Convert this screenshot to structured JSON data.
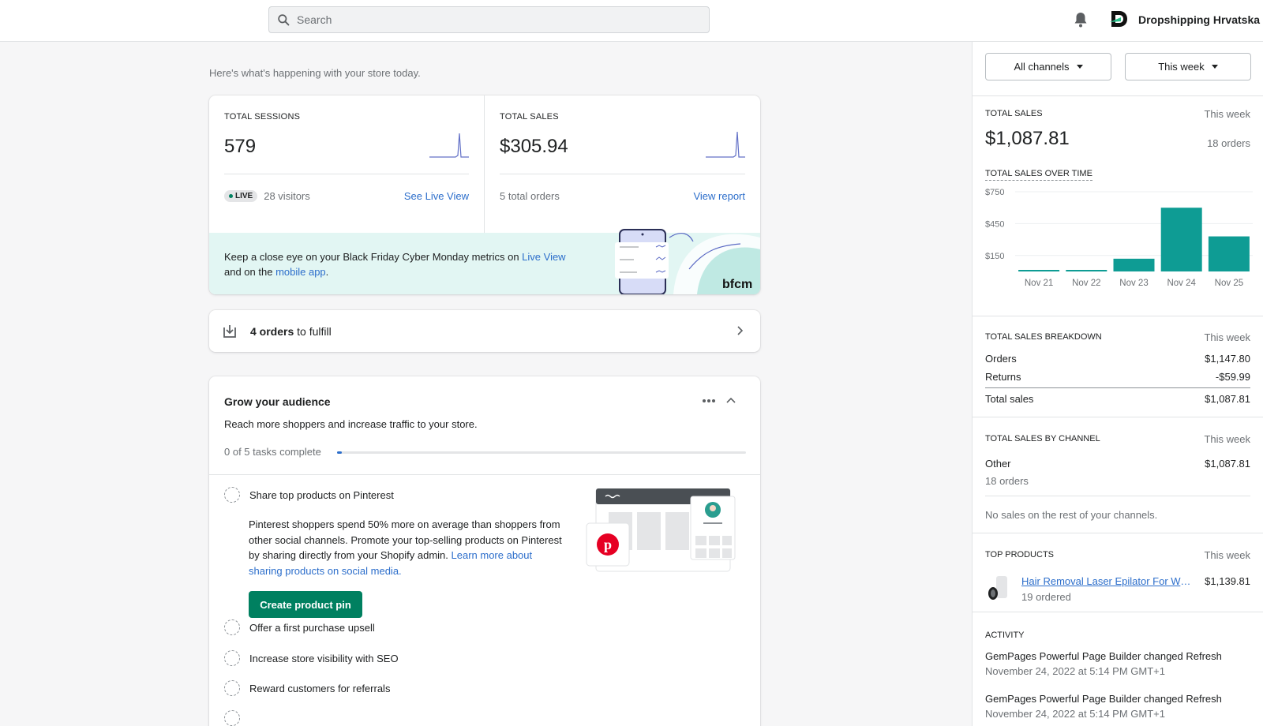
{
  "topbar": {
    "search_placeholder": "Search",
    "store_name": "Dropshipping Hrvatska",
    "icons": [
      "search-icon",
      "bell-icon",
      "store-logo-icon"
    ]
  },
  "main": {
    "subtitle": "Here's what's happening with your store today.",
    "sessions": {
      "label": "TOTAL SESSIONS",
      "value": "579",
      "live_badge": "LIVE",
      "visitors": "28 visitors",
      "link": "See Live View"
    },
    "sales": {
      "label": "TOTAL SALES",
      "value": "$305.94",
      "orders": "5 total orders",
      "link": "View report"
    },
    "banner": {
      "text_a": "Keep a close eye on your Black Friday Cyber Monday metrics on ",
      "link_a": "Live View",
      "text_b": " and on the ",
      "link_b": "mobile app",
      "text_c": ".",
      "art_label": "bfcm"
    },
    "fulfill": {
      "count": "4 orders",
      "rest": " to fulfill"
    },
    "grow": {
      "title": "Grow your audience",
      "description": "Reach more shoppers and increase traffic to your store.",
      "progress_label": "0 of 5 tasks complete",
      "progress_fraction": 0.0,
      "tasks": [
        "Share top products on Pinterest",
        "Offer a first purchase upsell",
        "Increase store visibility with SEO",
        "Reward customers for referrals"
      ],
      "task_body": "Pinterest shoppers spend 50% more on average than shoppers from other social channels. Promote your top-selling products on Pinterest by sharing directly from your Shopify admin. ",
      "task_link": "Learn more about sharing products on social media.",
      "cta": "Create product pin"
    }
  },
  "side": {
    "channels_button": "All channels",
    "period_button": "This week",
    "total_sales": {
      "label": "TOTAL SALES",
      "period": "This week",
      "value": "$1,087.81",
      "orders": "18 orders",
      "over_time_label": "TOTAL SALES OVER TIME"
    },
    "breakdown": {
      "label": "TOTAL SALES BREAKDOWN",
      "period": "This week",
      "rows": [
        {
          "name": "Orders",
          "value": "$1,147.80"
        },
        {
          "name": "Returns",
          "value": "-$59.99"
        },
        {
          "name": "Total sales",
          "value": "$1,087.81"
        }
      ]
    },
    "by_channel": {
      "label": "TOTAL SALES BY CHANNEL",
      "period": "This week",
      "channel": "Other",
      "value": "$1,087.81",
      "orders": "18 orders",
      "note": "No sales on the rest of your channels."
    },
    "top_products": {
      "label": "TOP PRODUCTS",
      "period": "This week",
      "name": "Hair Removal Laser Epilator For Women",
      "value": "$1,139.81",
      "ordered": "19 ordered"
    },
    "activity": {
      "label": "ACTIVITY",
      "items": [
        {
          "text": "GemPages Powerful Page Builder changed Refresh",
          "time": "November 24, 2022 at 5:14 PM GMT+1"
        },
        {
          "text": "GemPages Powerful Page Builder changed Refresh",
          "time": "November 24, 2022 at 5:14 PM GMT+1"
        }
      ]
    }
  },
  "chart_data": {
    "type": "bar",
    "categories": [
      "Nov 21",
      "Nov 22",
      "Nov 23",
      "Nov 24",
      "Nov 25"
    ],
    "values": [
      8,
      8,
      120,
      600,
      330
    ],
    "y_ticks": [
      "$750",
      "$450",
      "$150"
    ],
    "ylim": [
      0,
      750
    ],
    "color": "#0e9c94",
    "grid": true
  },
  "colors": {
    "accent": "#008060",
    "link": "#2c6ecb",
    "banner_bg": "#e2f6f3",
    "bar": "#0e9c94"
  }
}
